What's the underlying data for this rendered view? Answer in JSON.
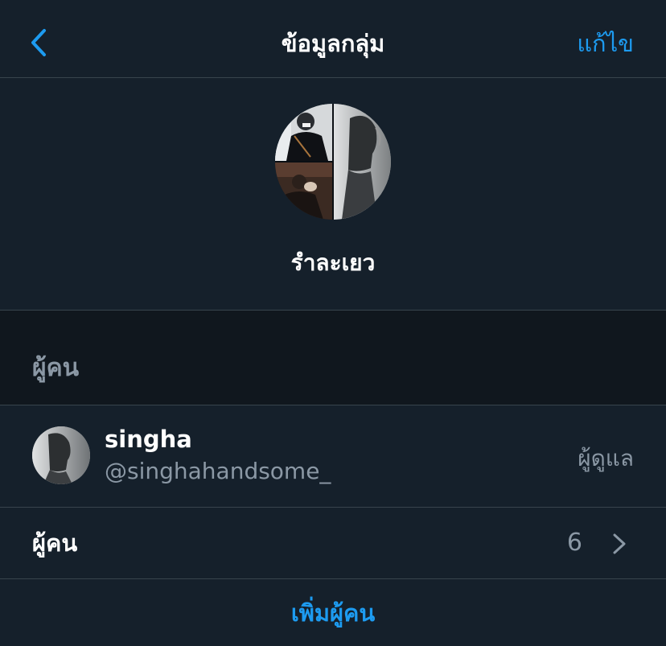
{
  "header": {
    "title": "ข้อมูลกลุ่ม",
    "edit_label": "แก้ไข",
    "back_icon": "chevron-left-icon"
  },
  "group": {
    "name": "รำละเยว"
  },
  "section": {
    "people_label": "ผู้คน"
  },
  "member": {
    "name": "singha",
    "handle": "@singhahandsome_",
    "role": "ผู้ดูแล"
  },
  "people_row": {
    "label": "ผู้คน",
    "count": "6"
  },
  "actions": {
    "add_people": "เพิ่มผู้คน"
  },
  "colors": {
    "background": "#15202b",
    "band": "#10171e",
    "divider": "#38444d",
    "accent": "#1d9bf0",
    "secondary_text": "#8b98a5"
  }
}
